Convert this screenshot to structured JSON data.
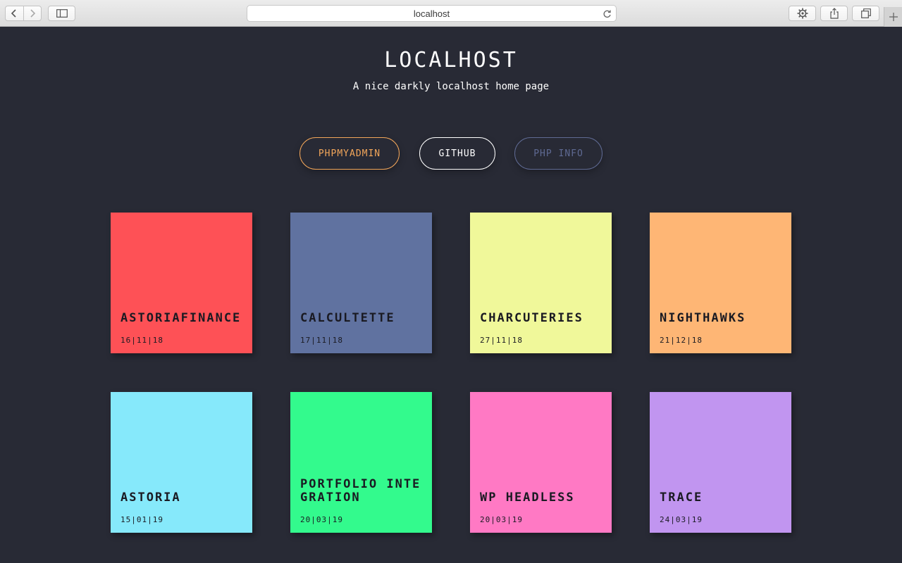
{
  "browser": {
    "url": "localhost"
  },
  "header": {
    "title": "LOCALHOST",
    "subtitle": "A nice darkly localhost home page"
  },
  "links": [
    {
      "label": "PHPMYADMIN",
      "color": "#f2a65a"
    },
    {
      "label": "GITHUB",
      "color": "#ffffff"
    },
    {
      "label": "PHP INFO",
      "color": "#5f6a93"
    }
  ],
  "projects": [
    {
      "name": "ASTORIAFINANCE",
      "date": "16|11|18",
      "color": "#fe5156"
    },
    {
      "name": "CALCULTETTE",
      "date": "17|11|18",
      "color": "#6072a0"
    },
    {
      "name": "CHARCUTERIES",
      "date": "27|11|18",
      "color": "#f0f89a"
    },
    {
      "name": "NIGHTHAWKS",
      "date": "21|12|18",
      "color": "#feb675"
    },
    {
      "name": "ASTORIA",
      "date": "15|01|19",
      "color": "#86e9fb"
    },
    {
      "name": "PORTFOLIO INTEGRATION",
      "date": "20|03|19",
      "color": "#33fa8d"
    },
    {
      "name": "WP HEADLESS",
      "date": "20|03|19",
      "color": "#ff79c4"
    },
    {
      "name": "TRACE",
      "date": "24|03|19",
      "color": "#c195f0"
    }
  ],
  "colors": {
    "background": "#282a35"
  }
}
